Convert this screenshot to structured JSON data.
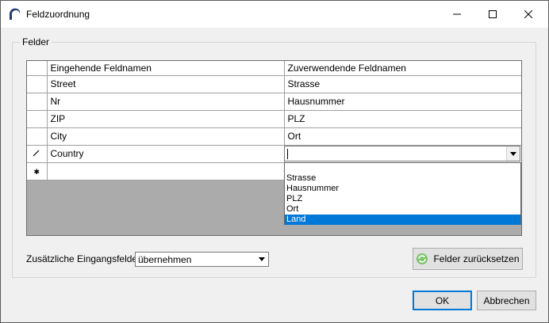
{
  "window": {
    "title": "Feldzuordnung"
  },
  "titlebar": {
    "min_icon": "minimize-icon",
    "max_icon": "maximize-icon",
    "close_icon": "close-icon"
  },
  "group": {
    "label": "Felder"
  },
  "grid": {
    "columns": [
      "Eingehende Feldnamen",
      "Zuverwendende Feldnamen"
    ],
    "rows": [
      {
        "incoming": "Street",
        "target": "Strasse"
      },
      {
        "incoming": "Nr",
        "target": "Hausnummer"
      },
      {
        "incoming": "ZIP",
        "target": "PLZ"
      },
      {
        "incoming": "City",
        "target": "Ort"
      },
      {
        "incoming": "Country",
        "target": ""
      }
    ],
    "edit_marker": "pencil-icon",
    "new_row_marker": "asterisk-icon"
  },
  "dropdown": {
    "options": [
      "Strasse",
      "Hausnummer",
      "PLZ",
      "Ort",
      "Land"
    ],
    "selected": "Land"
  },
  "extra_fields": {
    "label": "Zusätzliche Eingangsfelder",
    "value": "übernehmen"
  },
  "buttons": {
    "reset": "Felder zurücksetzen",
    "ok": "OK",
    "cancel": "Abbrechen"
  },
  "colors": {
    "selection": "#0078d7",
    "grid_background": "#ababab"
  }
}
